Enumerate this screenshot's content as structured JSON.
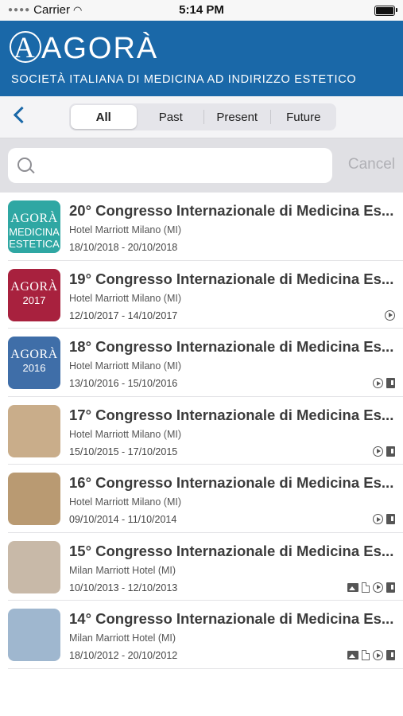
{
  "status_bar": {
    "carrier": "Carrier",
    "time": "5:14 PM"
  },
  "header": {
    "brand": "AGORÀ",
    "subtitle": "SOCIETÀ ITALIANA DI MEDICINA AD INDIRIZZO ESTETICO",
    "color": "#1a68a8"
  },
  "segments": {
    "options": [
      "All",
      "Past",
      "Present",
      "Future"
    ],
    "selected": "All"
  },
  "search": {
    "value": "",
    "placeholder": "",
    "cancel_label": "Cancel"
  },
  "events": [
    {
      "title": "20° Congresso Internazionale di Medicina Es...",
      "venue": "Hotel Marriott Milano (MI)",
      "dates": "18/10/2018 - 20/10/2018",
      "thumb": {
        "line1": "AGORÀ",
        "line2": "MEDICINA ESTETICA",
        "color": "#2fa7a3"
      },
      "icons": []
    },
    {
      "title": "19° Congresso Internazionale di Medicina Es...",
      "venue": "Hotel Marriott Milano (MI)",
      "dates": "12/10/2017 - 14/10/2017",
      "thumb": {
        "line1": "AGORÀ",
        "line2": "2017",
        "color": "#a8213e"
      },
      "icons": [
        "play-icon"
      ]
    },
    {
      "title": "18° Congresso Internazionale di Medicina Es...",
      "venue": "Hotel Marriott Milano (MI)",
      "dates": "13/10/2016 - 15/10/2016",
      "thumb": {
        "line1": "AGORÀ",
        "line2": "2016",
        "color": "#3f6ea8"
      },
      "icons": [
        "play-icon",
        "book-icon"
      ]
    },
    {
      "title": "17° Congresso Internazionale di Medicina Es...",
      "venue": "Hotel Marriott Milano (MI)",
      "dates": "15/10/2015 - 17/10/2015",
      "thumb": {
        "line1": "",
        "line2": "",
        "color": "#c9ad8a"
      },
      "icons": [
        "play-icon",
        "book-icon"
      ]
    },
    {
      "title": "16° Congresso Internazionale di Medicina Es...",
      "venue": "Hotel Marriott Milano (MI)",
      "dates": "09/10/2014 - 11/10/2014",
      "thumb": {
        "line1": "",
        "line2": "",
        "color": "#b99a72"
      },
      "icons": [
        "play-icon",
        "book-icon"
      ]
    },
    {
      "title": "15° Congresso Internazionale di Medicina Es...",
      "venue": "Milan Marriott Hotel (MI)",
      "dates": "10/10/2013 - 12/10/2013",
      "thumb": {
        "line1": "",
        "line2": "",
        "color": "#c8b9a8"
      },
      "icons": [
        "image-icon",
        "document-icon",
        "play-icon",
        "book-icon"
      ]
    },
    {
      "title": "14° Congresso Internazionale di Medicina Es...",
      "venue": "Milan Marriott Hotel (MI)",
      "dates": "18/10/2012 - 20/10/2012",
      "thumb": {
        "line1": "",
        "line2": "",
        "color": "#9fb7cf"
      },
      "icons": [
        "image-icon",
        "document-icon",
        "play-icon",
        "book-icon"
      ]
    }
  ]
}
